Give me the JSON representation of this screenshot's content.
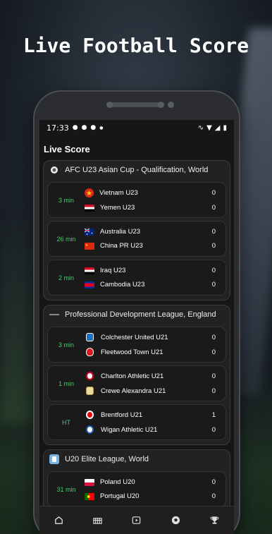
{
  "headline": "Live Football Score",
  "status_bar": {
    "time": "17:33"
  },
  "app": {
    "title": "Live Score"
  },
  "leagues": [
    {
      "name": "AFC U23 Asian Cup - Qualification, World",
      "logo_icon": "afc-logo-icon",
      "matches": [
        {
          "time": "3 min",
          "home": {
            "name": "Vietnam U23",
            "score": "0",
            "flag": "vietnam-flag-icon"
          },
          "away": {
            "name": "Yemen U23",
            "score": "0",
            "flag": "yemen-flag-icon"
          }
        },
        {
          "time": "26 min",
          "home": {
            "name": "Australia U23",
            "score": "0",
            "flag": "australia-flag-icon"
          },
          "away": {
            "name": "China PR U23",
            "score": "0",
            "flag": "china-flag-icon"
          }
        },
        {
          "time": "2 min",
          "home": {
            "name": "Iraq U23",
            "score": "0",
            "flag": "iraq-flag-icon"
          },
          "away": {
            "name": "Cambodia U23",
            "score": "0",
            "flag": "cambodia-flag-icon"
          }
        }
      ]
    },
    {
      "name": "Professional Development League, England",
      "logo_icon": "pdl-logo-icon",
      "matches": [
        {
          "time": "3 min",
          "home": {
            "name": "Colchester United U21",
            "score": "0",
            "flag": "colchester-crest-icon"
          },
          "away": {
            "name": "Fleetwood Town U21",
            "score": "0",
            "flag": "fleetwood-crest-icon"
          }
        },
        {
          "time": "1 min",
          "home": {
            "name": "Charlton Athletic U21",
            "score": "0",
            "flag": "charlton-crest-icon"
          },
          "away": {
            "name": "Crewe Alexandra U21",
            "score": "0",
            "flag": "crewe-crest-icon"
          }
        },
        {
          "time": "HT",
          "home": {
            "name": "Brentford U21",
            "score": "1",
            "flag": "brentford-crest-icon"
          },
          "away": {
            "name": "Wigan Athletic U21",
            "score": "0",
            "flag": "wigan-crest-icon"
          }
        }
      ]
    },
    {
      "name": "U20 Elite League, World",
      "logo_icon": "u20-league-logo-icon",
      "matches": [
        {
          "time": "31 min",
          "home": {
            "name": "Poland U20",
            "score": "0",
            "flag": "poland-flag-icon"
          },
          "away": {
            "name": "Portugal U20",
            "score": "0",
            "flag": "portugal-flag-icon"
          }
        }
      ]
    }
  ],
  "nav": [
    "home-icon",
    "stadium-icon",
    "video-icon",
    "football-icon",
    "trophy-icon"
  ],
  "colors": {
    "accent_green": "#3fcf6a",
    "card": "#222222",
    "screen_bg": "#161616"
  }
}
